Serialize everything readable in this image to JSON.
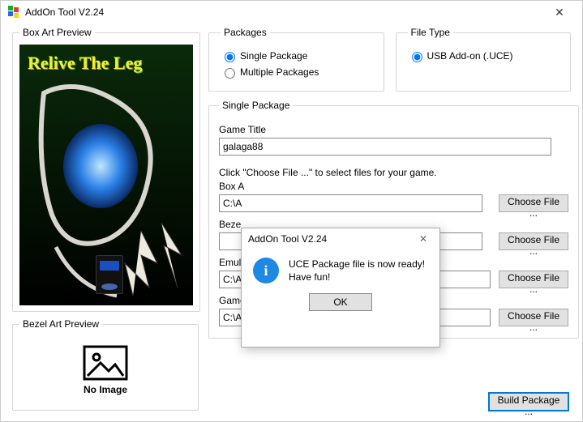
{
  "window": {
    "title": "AddOn Tool V2.24"
  },
  "left": {
    "box_art_legend": "Box Art Preview",
    "box_art_text": "Relive The Leg",
    "bezel_legend": "Bezel Art Preview",
    "noimg": "No Image"
  },
  "packages": {
    "legend": "Packages",
    "single": "Single Package",
    "multiple": "Multiple Packages"
  },
  "filetype": {
    "legend": "File Type",
    "uce": "USB Add-on (.UCE)"
  },
  "single": {
    "legend": "Single Package",
    "game_title_label": "Game Title",
    "game_title_value": "galaga88",
    "click_hint": "Click \"Choose File ...\" to select files for your game.",
    "box_label": "Box A",
    "box_value": "C:\\A",
    "bezel_label": "Beze",
    "bezel_value": "",
    "emu_label": "Emul",
    "emu_value": "C:\\ALP\\mame2003_plus_libretro.so",
    "rom_label": "Game ROM",
    "rom_value": "C:\\ALP\\roms\\mame2003\\galaga88.zip",
    "choose": "Choose File ..."
  },
  "build_label": "Build Package ...",
  "dialog": {
    "title": "AddOn Tool V2.24",
    "line1": "UCE Package file is now ready!",
    "line2": "Have fun!",
    "ok": "OK"
  }
}
